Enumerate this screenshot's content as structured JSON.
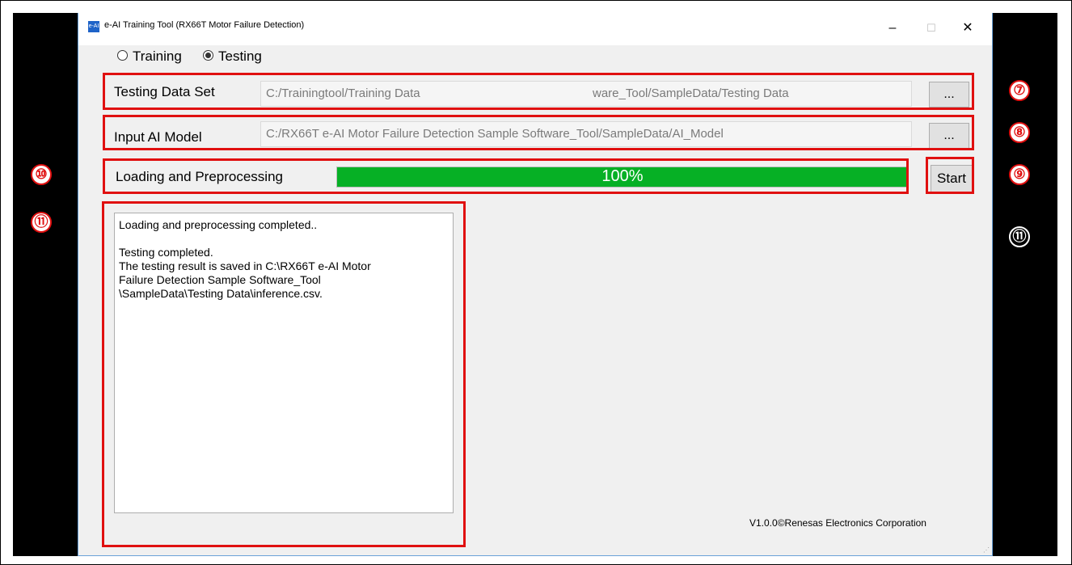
{
  "window": {
    "title": "e-AI Training Tool (RX66T Motor Failure Detection)",
    "icon_text": "e-AI",
    "minimize": "–",
    "maximize": "☐",
    "close": "✕"
  },
  "mode": {
    "training_label": "Training",
    "testing_label": "Testing",
    "selected": "Testing"
  },
  "testing_data_set": {
    "label": "Testing Data Set",
    "value_left": "C:/Trainingtool/Training Data",
    "value_right": "ware_Tool/SampleData/Testing Data",
    "browse_label": "..."
  },
  "input_ai_model": {
    "label": "Input AI Model",
    "value": "C:/RX66T e-AI Motor Failure Detection Sample Software_Tool/SampleData/AI_Model",
    "browse_label": "..."
  },
  "progress": {
    "label": "Loading and Preprocessing",
    "text": "100%",
    "value": 1.0,
    "color": "#06b025"
  },
  "start_button": {
    "label": "Start"
  },
  "log": {
    "lines": [
      "Loading and preprocessing completed..",
      "",
      "Testing completed.",
      "The testing result is saved in C:\\RX66T e-AI Motor",
      "Failure Detection Sample Software_Tool",
      "\\SampleData\\Testing Data\\inference.csv."
    ]
  },
  "footer": {
    "version": "V1.0.0©Renesas Electronics Corporation"
  },
  "annotations": {
    "badge_7": "⑦",
    "badge_8": "⑧",
    "badge_9": "⑨",
    "badge_10": "⑩",
    "badge_11_left": "⑪",
    "badge_11_right": "⑪",
    "highlight_color": "#e01010"
  }
}
